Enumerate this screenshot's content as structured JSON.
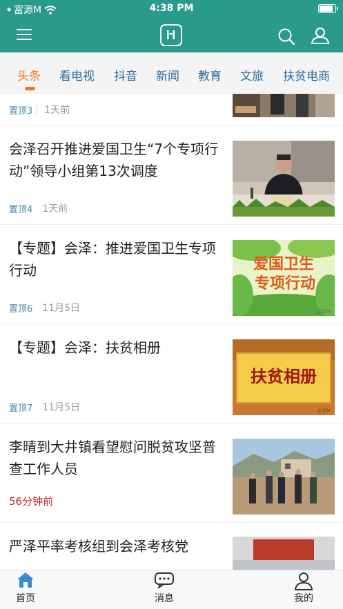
{
  "status": {
    "carrier": "富源M",
    "time": "4:38 PM",
    "battery_level": 0.9
  },
  "header": {
    "menu_icon": "menu-icon",
    "logo_icon": "app-logo-icon",
    "search_icon": "search-icon",
    "user_icon": "user-icon",
    "accent": "#2a9a8a"
  },
  "tabs": [
    {
      "label": "头条",
      "active": true
    },
    {
      "label": "看电视"
    },
    {
      "label": "抖音"
    },
    {
      "label": "新闻"
    },
    {
      "label": "教育"
    },
    {
      "label": "文旅"
    },
    {
      "label": "扶贫电商"
    }
  ],
  "feed": [
    {
      "pin": "置顶3",
      "date": "1天前"
    },
    {
      "title": "会泽召开推进爱国卫生“7个专项行动”领导小组第13次调度",
      "pin": "置顶4",
      "date": "1天前"
    },
    {
      "title": "【专题】会泽：推进爱国卫生专项行动",
      "pin": "置顶6",
      "date": "11月5日",
      "thumb_text_1": "爱国卫生",
      "thumb_text_2": "专项行动",
      "thumb_watermark": "会泽M"
    },
    {
      "title": "【专题】会泽：扶贫相册",
      "pin": "置顶7",
      "date": "11月5日",
      "thumb_text": "扶贫相册",
      "thumb_watermark": "会泽M"
    },
    {
      "title": "李晴到大井镇看望慰问脱贫攻坚普查工作人员",
      "date": "56分钟前"
    },
    {
      "title": "严泽平率考核组到会泽考核党"
    }
  ],
  "bottom_nav": [
    {
      "label": "首页",
      "icon": "home-icon",
      "active": true
    },
    {
      "label": "消息",
      "icon": "message-icon"
    },
    {
      "label": "我的",
      "icon": "profile-icon"
    }
  ]
}
